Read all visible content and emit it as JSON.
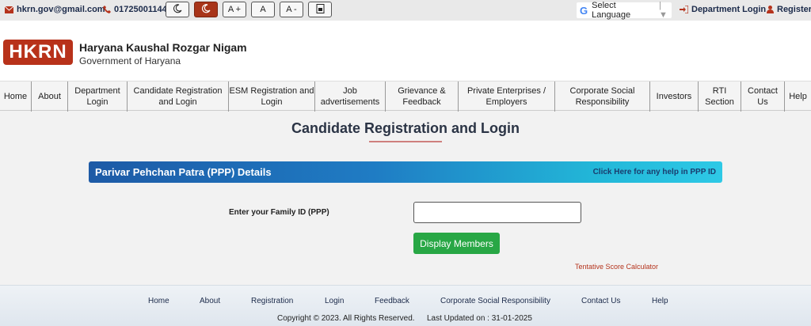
{
  "topbar": {
    "email": "hkrn.gov@gmail.com",
    "phone": "01725001144",
    "font_increase": "A +",
    "font_normal": "A",
    "font_decrease": "A -",
    "language_select": "Select Language",
    "department_login": "Department Login",
    "register": "Register"
  },
  "header": {
    "logo_text": "HKRN",
    "org_name": "Haryana Kaushal Rozgar Nigam",
    "org_sub": "Government of Haryana"
  },
  "nav": {
    "items": [
      {
        "label": "Home"
      },
      {
        "label": "About"
      },
      {
        "label": "Department Login"
      },
      {
        "label": "Candidate Registration and Login"
      },
      {
        "label": "ESM Registration and Login"
      },
      {
        "label": "Job advertisements"
      },
      {
        "label": "Grievance & Feedback"
      },
      {
        "label": "Private Enterprises / Employers"
      },
      {
        "label": "Corporate Social Responsibility"
      },
      {
        "label": "Investors"
      },
      {
        "label": "RTI Section"
      },
      {
        "label": "Contact Us"
      },
      {
        "label": "Help"
      }
    ]
  },
  "main": {
    "page_title": "Candidate Registration and Login",
    "ppp_title": "Parivar Pehchan Patra (PPP) Details",
    "ppp_help": "Click Here for any help in PPP ID",
    "family_label": "Enter your Family ID (PPP)",
    "family_value": "",
    "display_button": "Display Members",
    "score_calculator": "Tentative Score Calculator"
  },
  "footer": {
    "links": [
      "Home",
      "About",
      "Registration",
      "Login",
      "Feedback",
      "Corporate Social Responsibility",
      "Contact Us",
      "Help"
    ],
    "copyright": "Copyright © 2023. All Rights Reserved.",
    "last_updated": "Last Updated on : 31-01-2025"
  },
  "colors": {
    "brand": "#b8321a",
    "button_green": "#28a745",
    "ppp_gradient_start": "#1d5aa6",
    "ppp_gradient_end": "#2ec9e6"
  }
}
